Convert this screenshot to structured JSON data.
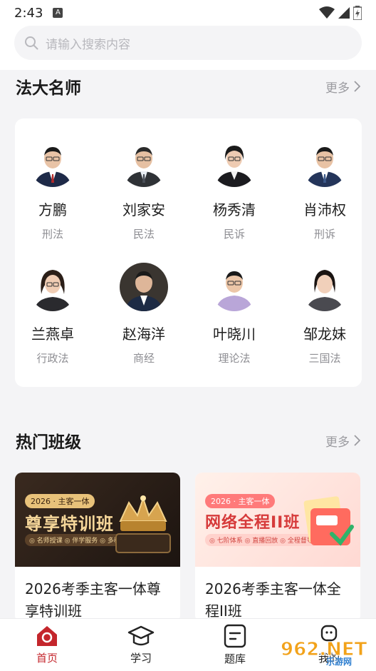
{
  "status_bar": {
    "time": "2:43",
    "notif_icon": "A"
  },
  "search": {
    "placeholder": "请输入搜索内容"
  },
  "teachers_section": {
    "title": "法大名师",
    "more": "更多",
    "teachers": [
      {
        "name": "方鹏",
        "subject": "刑法"
      },
      {
        "name": "刘家安",
        "subject": "民法"
      },
      {
        "name": "杨秀清",
        "subject": "民诉"
      },
      {
        "name": "肖沛权",
        "subject": "刑诉"
      },
      {
        "name": "兰燕卓",
        "subject": "行政法"
      },
      {
        "name": "赵海洋",
        "subject": "商经"
      },
      {
        "name": "叶晓川",
        "subject": "理论法"
      },
      {
        "name": "邹龙妹",
        "subject": "三国法"
      }
    ]
  },
  "classes_section": {
    "title": "热门班级",
    "more": "更多",
    "classes": [
      {
        "tag": "2026 · 主客一体",
        "banner_title": "尊享特训班",
        "features": "◎ 名师授课 ◎ 伴学服务 ◎ 多种模式答疑",
        "title": "2026考季主客一体尊享特训班"
      },
      {
        "tag": "2026 · 主客一体",
        "banner_title": "网络全程II班",
        "features": "◎ 七阶体系 ◎ 直播回放 ◎ 全程督导",
        "title": "2026考季主客一体全程II班"
      }
    ]
  },
  "tab_bar": {
    "tabs": [
      {
        "label": "首页",
        "active": true
      },
      {
        "label": "学习",
        "active": false
      },
      {
        "label": "题库",
        "active": false
      },
      {
        "label": "我的",
        "active": false
      }
    ]
  },
  "watermark": {
    "text": "962.NET",
    "sub": "乐游网"
  },
  "colors": {
    "accent": "#c4262c",
    "background": "#f4f4f6"
  }
}
